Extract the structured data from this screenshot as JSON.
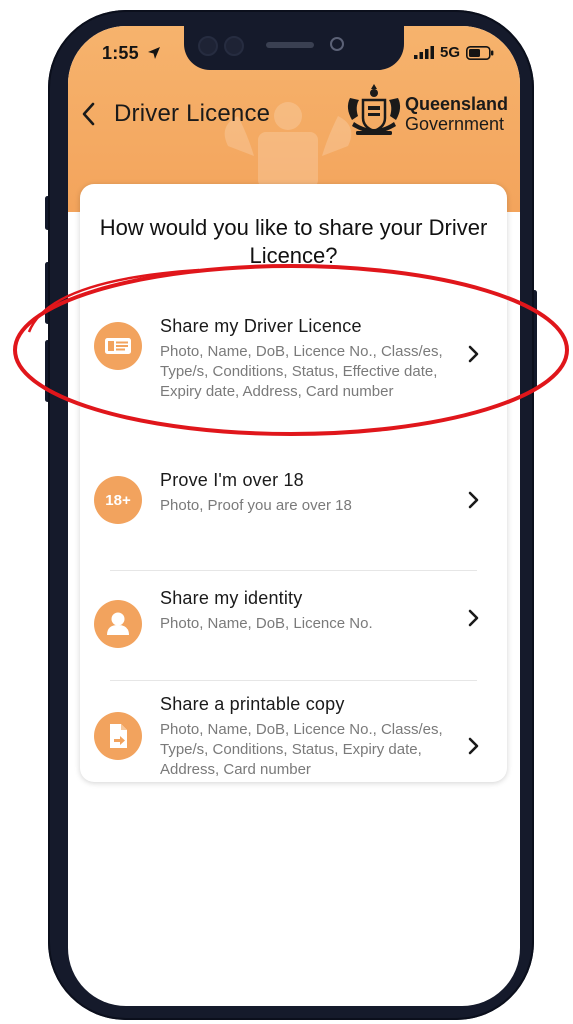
{
  "status_bar": {
    "time": "1:55",
    "network": "5G"
  },
  "nav": {
    "title": "Driver Licence"
  },
  "brand": {
    "line1": "Queensland",
    "line2": "Government"
  },
  "card": {
    "question": "How would you like to share your Driver Licence?"
  },
  "options": [
    {
      "icon": "id-card-icon",
      "title": "Share my Driver Licence",
      "description": "Photo, Name, DoB, Licence No., Class/es, Type/s, Conditions, Status, Effective date, Expiry date, Address, Card number"
    },
    {
      "icon": "18-plus-icon",
      "icon_text": "18+",
      "title": "Prove I'm over 18",
      "description": "Photo, Proof you are over 18"
    },
    {
      "icon": "person-icon",
      "title": "Share my identity",
      "description": "Photo, Name, DoB, Licence No."
    },
    {
      "icon": "document-share-icon",
      "title": "Share a printable copy",
      "description": "Photo, Name, DoB, Licence No., Class/es, Type/s, Conditions, Status, Expiry date, Address, Card number"
    }
  ],
  "colors": {
    "header_orange": "#f3a45c",
    "icon_orange": "#f2a35e",
    "highlight_red": "#e0161b"
  }
}
